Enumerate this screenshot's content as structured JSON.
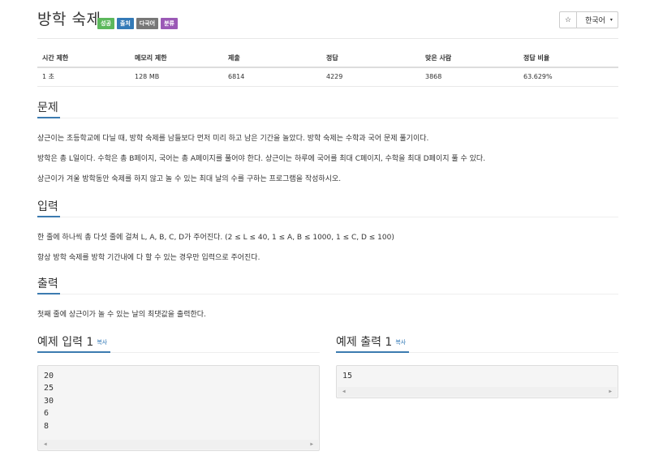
{
  "problem": {
    "title": "방학 숙제",
    "labels": [
      "성공",
      "출처",
      "다국어",
      "분류"
    ],
    "star_icon": "☆",
    "language": "한국어",
    "caret_icon": "▾"
  },
  "info_table": {
    "headers": [
      "시간 제한",
      "메모리 제한",
      "제출",
      "정답",
      "맞은 사람",
      "정답 비율"
    ],
    "values": [
      "1 초",
      "128 MB",
      "6814",
      "4229",
      "3868",
      "63.629%"
    ]
  },
  "sections": {
    "description": {
      "title": "문제",
      "paragraphs": [
        "상근이는 초등학교에 다닐 때, 방학 숙제를 남들보다 먼저 미리 하고 남은 기간을 놀았다. 방학 숙제는 수학과 국어 문제 풀기이다.",
        "방학은 총 L일이다. 수학은 총 B페이지, 국어는 총 A페이지를 풀어야 한다. 상근이는 하루에 국어를 최대 C페이지, 수학을 최대 D페이지 풀 수 있다.",
        "상근이가 겨울 방학동안 숙제를 하지 않고 놀 수 있는 최대 날의 수를 구하는 프로그램을 작성하시오."
      ]
    },
    "input": {
      "title": "입력",
      "paragraphs": [
        "한 줄에 하나씩 총 다섯 줄에 걸쳐 L, A, B, C, D가 주어진다. (2 ≤ L ≤ 40, 1 ≤ A, B ≤ 1000, 1 ≤ C, D ≤ 100)",
        "항상 방학 숙제를 방학 기간내에 다 할 수 있는 경우만 입력으로 주어진다."
      ]
    },
    "output": {
      "title": "출력",
      "paragraphs": [
        "첫째 줄에 상근이가 놀 수 있는 날의 최댓값을 출력한다."
      ]
    }
  },
  "samples": {
    "input": {
      "title": "예제 입력 1",
      "copy_label": "복사",
      "lines": [
        "20",
        "25",
        "30",
        "6",
        "8"
      ]
    },
    "output": {
      "title": "예제 출력 1",
      "copy_label": "복사",
      "lines": [
        "15"
      ]
    },
    "scroll_left_icon": "◀",
    "scroll_right_icon": "▶"
  },
  "colors": {
    "accent": "#3c7bb0",
    "label_success": "#5cb85c",
    "label_primary": "#337ab7",
    "label_default": "#777777",
    "label_purple": "#9b59b6"
  }
}
